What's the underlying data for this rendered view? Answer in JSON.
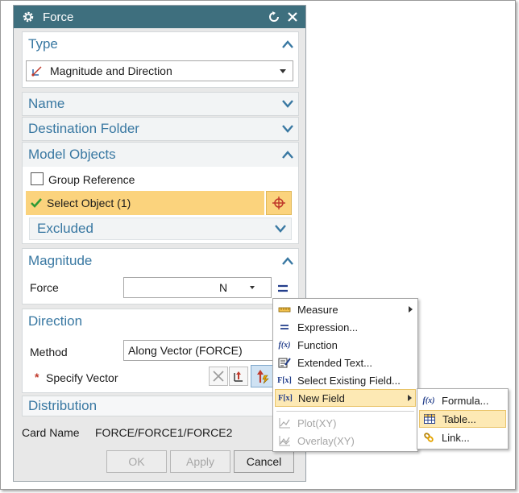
{
  "dialog": {
    "title": "Force",
    "sections": {
      "type": {
        "title": "Type",
        "selected": "Magnitude and Direction"
      },
      "name": {
        "title": "Name"
      },
      "destination": {
        "title": "Destination Folder"
      },
      "model_objects": {
        "title": "Model Objects",
        "group_reference": "Group Reference",
        "select_object": "Select Object (1)",
        "excluded": "Excluded"
      },
      "magnitude": {
        "title": "Magnitude",
        "force_label": "Force",
        "unit": "N"
      },
      "direction": {
        "title": "Direction",
        "method_label": "Method",
        "method_value": "Along Vector (FORCE)",
        "specify_vector": "Specify Vector",
        "required_marker": "*"
      },
      "distribution": {
        "title": "Distribution"
      }
    },
    "card_name_label": "Card Name",
    "card_name_value": "FORCE/FORCE1/FORCE2",
    "buttons": {
      "ok": "OK",
      "apply": "Apply",
      "cancel": "Cancel"
    }
  },
  "context_menu": {
    "items": [
      {
        "label": "Measure",
        "submenu": true
      },
      {
        "label": "Expression..."
      },
      {
        "label": "Function"
      },
      {
        "label": "Extended Text..."
      },
      {
        "label": "Select Existing Field..."
      },
      {
        "label": "New Field",
        "submenu": true
      },
      {
        "label": "Plot(XY)",
        "disabled": true
      },
      {
        "label": "Overlay(XY)",
        "disabled": true
      }
    ]
  },
  "submenu": {
    "items": [
      {
        "label": "Formula..."
      },
      {
        "label": "Table..."
      },
      {
        "label": "Link..."
      }
    ]
  },
  "colors": {
    "titlebar": "#3e6f7e",
    "section_text": "#3978a2",
    "selection": "#fbd37d",
    "menu_highlight": "#fde9b4"
  }
}
